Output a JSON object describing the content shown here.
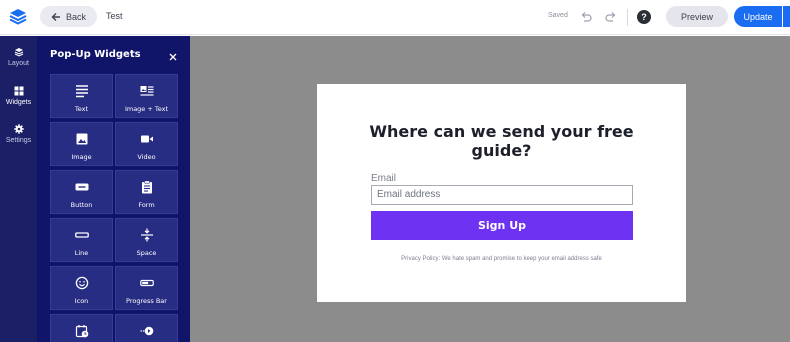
{
  "topbar": {
    "back_label": "Back",
    "page_name": "Test",
    "saved_label": "Saved",
    "preview_label": "Preview",
    "update_label": "Update",
    "help_label": "?"
  },
  "rail": {
    "items": [
      {
        "label": "Layout",
        "icon": "layers-icon"
      },
      {
        "label": "Widgets",
        "icon": "grid-icon"
      },
      {
        "label": "Settings",
        "icon": "gear-icon"
      }
    ]
  },
  "panel": {
    "title": "Pop-Up Widgets",
    "widgets": [
      {
        "label": "Text",
        "icon": "text-lines-icon"
      },
      {
        "label": "Image + Text",
        "icon": "image-text-icon"
      },
      {
        "label": "Image",
        "icon": "image-icon"
      },
      {
        "label": "Video",
        "icon": "video-icon"
      },
      {
        "label": "Button",
        "icon": "button-icon"
      },
      {
        "label": "Form",
        "icon": "clipboard-icon"
      },
      {
        "label": "Line",
        "icon": "line-icon"
      },
      {
        "label": "Space",
        "icon": "space-icon"
      },
      {
        "label": "Icon",
        "icon": "smiley-icon"
      },
      {
        "label": "Progress Bar",
        "icon": "progress-bar-icon"
      },
      {
        "label": "",
        "icon": "calendar-clock-icon"
      },
      {
        "label": "",
        "icon": "arrow-circle-icon"
      }
    ]
  },
  "popup": {
    "headline": "Where can we send your free guide?",
    "email_label": "Email",
    "email_placeholder": "Email address",
    "button_label": "Sign Up",
    "privacy_text": "Privacy Policy: We hate spam and promise to keep your email address safe"
  },
  "colors": {
    "rail_bg": "#1a1f66",
    "panel_bg": "#11156a",
    "tile_bg": "#282d84",
    "canvas_bg": "#8c8c8c",
    "accent_blue": "#1a6cf0",
    "signup_purple": "#6e33f2"
  }
}
